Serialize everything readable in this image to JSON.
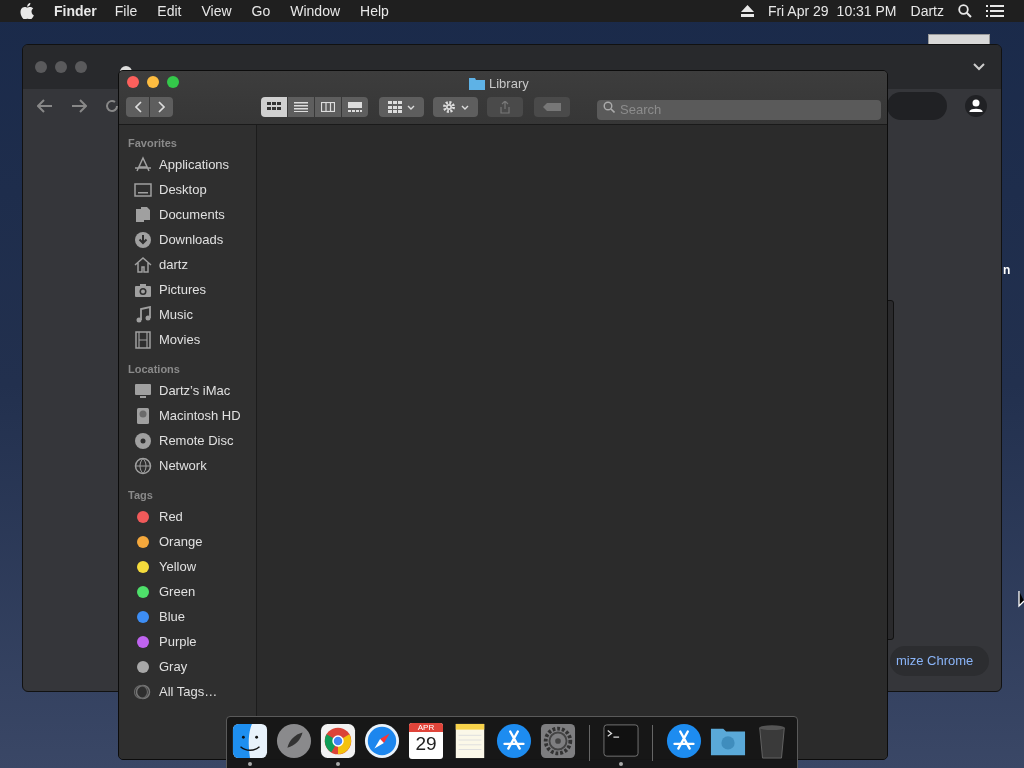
{
  "menu_bar": {
    "app_name": "Finder",
    "menus": [
      "File",
      "Edit",
      "View",
      "Go",
      "Window",
      "Help"
    ],
    "date": "Fri Apr 29",
    "time": "10:31 PM",
    "user": "Dartz"
  },
  "browser_window": {
    "customize_button": "mize Chrome",
    "edge_text": "n"
  },
  "finder_window": {
    "title": "Library",
    "view_modes": [
      {
        "kind": "icons",
        "selected": true
      },
      {
        "kind": "list",
        "selected": false
      },
      {
        "kind": "columns",
        "selected": false
      },
      {
        "kind": "gallery",
        "selected": false
      }
    ],
    "search": {
      "placeholder": "Search"
    },
    "sidebar": [
      {
        "heading": "Favorites",
        "items": [
          {
            "label": "Applications",
            "kind": "apps"
          },
          {
            "label": "Desktop",
            "kind": "desktop"
          },
          {
            "label": "Documents",
            "kind": "documents"
          },
          {
            "label": "Downloads",
            "kind": "downloads"
          },
          {
            "label": "dartz",
            "kind": "home"
          },
          {
            "label": "Pictures",
            "kind": "camera"
          },
          {
            "label": "Music",
            "kind": "music"
          },
          {
            "label": "Movies",
            "kind": "film"
          }
        ]
      },
      {
        "heading": "Locations",
        "items": [
          {
            "label": "Dartz’s iMac",
            "kind": "monitor"
          },
          {
            "label": "Macintosh HD",
            "kind": "disk"
          },
          {
            "label": "Remote Disc",
            "kind": "disc"
          },
          {
            "label": "Network",
            "kind": "globe"
          }
        ]
      },
      {
        "heading": "Tags",
        "items": [
          {
            "label": "Red",
            "kind": "tag",
            "color": "#f05a5a"
          },
          {
            "label": "Orange",
            "kind": "tag",
            "color": "#f5a83c"
          },
          {
            "label": "Yellow",
            "kind": "tag",
            "color": "#f5dc3c"
          },
          {
            "label": "Green",
            "kind": "tag",
            "color": "#4ee06a"
          },
          {
            "label": "Blue",
            "kind": "tag",
            "color": "#3d8ef5"
          },
          {
            "label": "Purple",
            "kind": "tag",
            "color": "#c064f0"
          },
          {
            "label": "Gray",
            "kind": "tag",
            "color": "#a8a8a8"
          },
          {
            "label": "All Tags…",
            "kind": "alltags"
          }
        ]
      }
    ]
  },
  "dock": [
    {
      "kind": "finder",
      "running": true
    },
    {
      "kind": "launchpad",
      "running": false
    },
    {
      "kind": "chrome",
      "running": true
    },
    {
      "kind": "safari",
      "running": false
    },
    {
      "kind": "calendar",
      "running": false,
      "month": "APR",
      "day": "29"
    },
    {
      "kind": "notes",
      "running": false
    },
    {
      "kind": "appstore",
      "running": false
    },
    {
      "kind": "settings",
      "running": false
    },
    {
      "kind": "separator"
    },
    {
      "kind": "terminal",
      "running": true
    },
    {
      "kind": "separator"
    },
    {
      "kind": "appstore",
      "running": false
    },
    {
      "kind": "folder",
      "running": false
    },
    {
      "kind": "trash",
      "running": false
    }
  ]
}
